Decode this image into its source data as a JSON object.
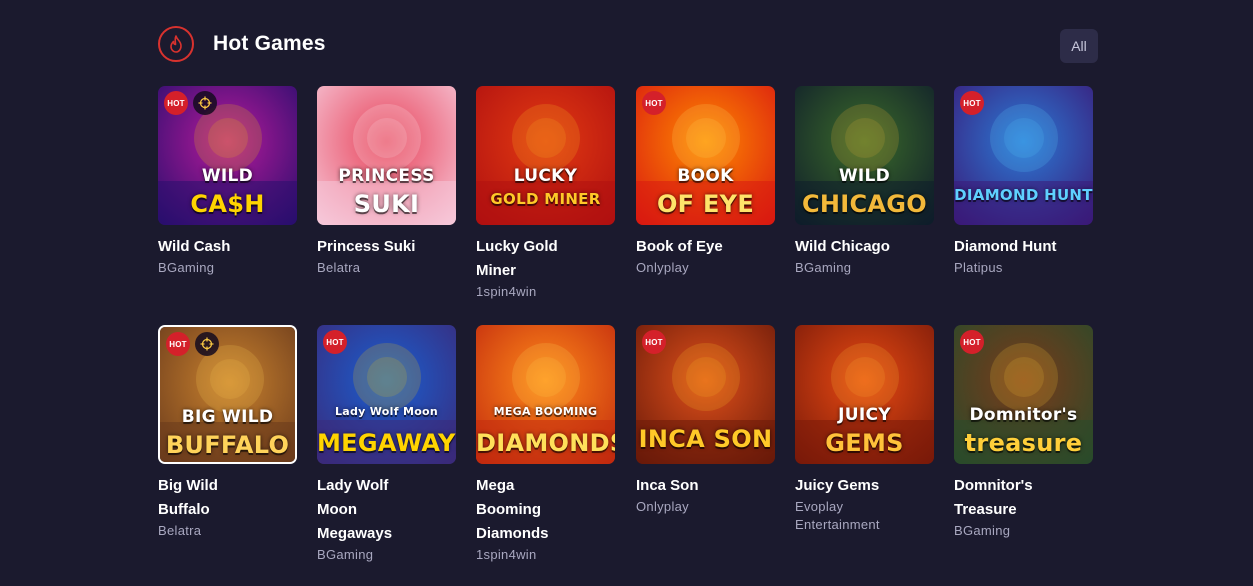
{
  "section": {
    "title": "Hot Games",
    "all_label": "All",
    "icon": "fire-icon",
    "accent": "#d8322e"
  },
  "badges": {
    "hot": "HOT"
  },
  "games": [
    {
      "name": "Wild Cash",
      "provider": "BGaming",
      "hot": true,
      "target": true,
      "art": [
        "WILD",
        "CA$H"
      ],
      "colors": [
        "#2a0e6e",
        "#b61a9a",
        "#ffd400"
      ]
    },
    {
      "name": "Princess Suki",
      "provider": "Belatra",
      "hot": false,
      "target": false,
      "art": [
        "PRINCESS",
        "SUKI"
      ],
      "colors": [
        "#f6c7d8",
        "#e8435a",
        "#ffffff"
      ]
    },
    {
      "name": "Lucky Gold Miner",
      "provider": "1spin4win",
      "hot": false,
      "target": false,
      "art": [
        "LUCKY",
        "GOLD MINER"
      ],
      "colors": [
        "#b01010",
        "#e23a12",
        "#ffc928"
      ]
    },
    {
      "name": "Book of Eye",
      "provider": "Onlyplay",
      "hot": true,
      "target": false,
      "art": [
        "BOOK",
        "OF EYE"
      ],
      "colors": [
        "#d91a10",
        "#ff8a00",
        "#ffe36a"
      ]
    },
    {
      "name": "Wild Chicago",
      "provider": "BGaming",
      "hot": false,
      "target": false,
      "art": [
        "WILD",
        "CHICAGO"
      ],
      "colors": [
        "#0f1d2a",
        "#3b6b2a",
        "#f3b93a"
      ]
    },
    {
      "name": "Diamond Hunt",
      "provider": "Platipus",
      "hot": true,
      "target": false,
      "art": [
        "",
        "DIAMOND HUNT"
      ],
      "colors": [
        "#3a1a78",
        "#2b7bd6",
        "#5fd0ff"
      ]
    },
    {
      "name": "Big Wild Buffalo",
      "provider": "Belatra",
      "hot": true,
      "target": true,
      "art": [
        "BIG WILD",
        "BUFFALO"
      ],
      "colors": [
        "#6a3a1c",
        "#c9822e",
        "#ffd35a"
      ]
    },
    {
      "name": "Lady Wolf Moon Megaways",
      "provider": "BGaming",
      "hot": true,
      "target": false,
      "art": [
        "Lady Wolf Moon",
        "MEGAWAYS"
      ],
      "colors": [
        "#3a2a7a",
        "#1a5fd0",
        "#ffd400"
      ]
    },
    {
      "name": "Mega Booming Diamonds",
      "provider": "1spin4win",
      "hot": false,
      "target": false,
      "art": [
        "MEGA BOOMING",
        "DIAMONDS"
      ],
      "colors": [
        "#c22a0e",
        "#ff8a1a",
        "#ffe05a"
      ]
    },
    {
      "name": "Inca Son",
      "provider": "Onlyplay",
      "hot": true,
      "target": false,
      "art": [
        "",
        "INCA SON"
      ],
      "colors": [
        "#6a1a0a",
        "#e0501a",
        "#ffc928"
      ]
    },
    {
      "name": "Juicy Gems",
      "provider": "Evoplay Entertainment",
      "hot": false,
      "target": false,
      "art": [
        "JUICY",
        "GEMS"
      ],
      "colors": [
        "#7a1a0a",
        "#e84a12",
        "#ffc23a"
      ]
    },
    {
      "name": "Domnitor's Treasure",
      "provider": "BGaming",
      "hot": true,
      "target": false,
      "art": [
        "Domnitor's",
        "treasure"
      ],
      "colors": [
        "#2a4a2a",
        "#7a3a1a",
        "#ffcf3a"
      ]
    }
  ]
}
